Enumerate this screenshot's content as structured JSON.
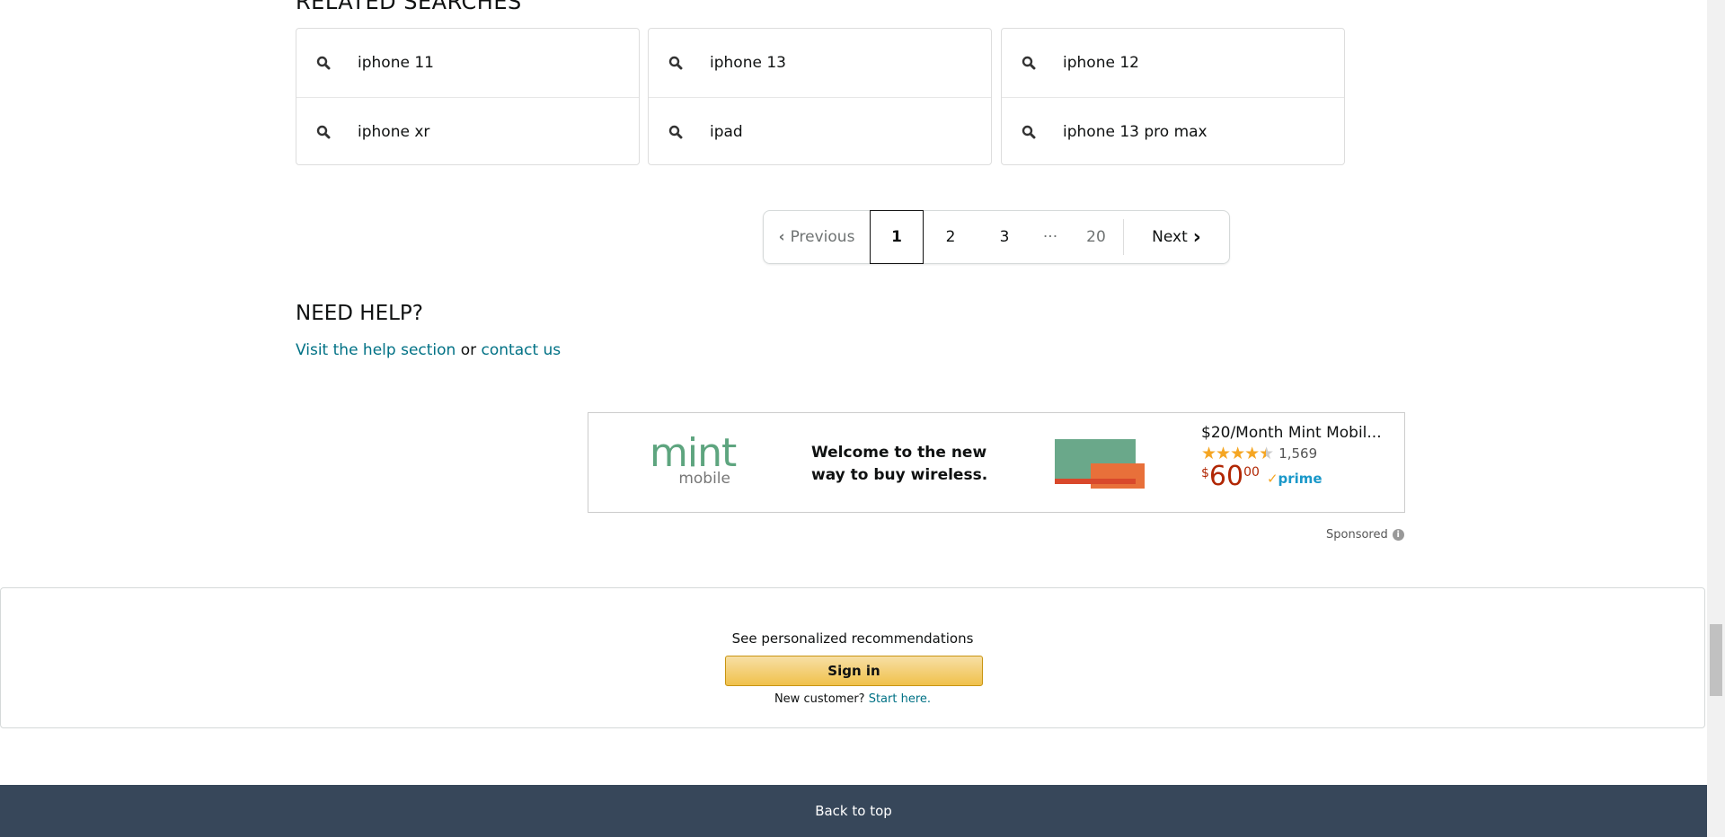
{
  "related": {
    "title": "RELATED SEARCHES",
    "columns": [
      [
        "iphone 11",
        "iphone xr"
      ],
      [
        "iphone 13",
        "ipad"
      ],
      [
        "iphone 12",
        "iphone 13 pro max"
      ]
    ]
  },
  "pagination": {
    "previous": "Previous",
    "current": "1",
    "pages": [
      "2",
      "3"
    ],
    "ellipsis": "···",
    "last": "20",
    "next": "Next"
  },
  "help": {
    "title": "NEED HELP?",
    "link1": "Visit the help section",
    "or": " or ",
    "link2": "contact us"
  },
  "ad": {
    "brand_logo": "mint mobile",
    "tagline_1": "Welcome to the new",
    "tagline_2": "way to buy wireless.",
    "product_title": "$20/Month Mint Mobil...",
    "rating": 4.5,
    "reviews": "1,569",
    "price_symbol": "$",
    "price_whole": "60",
    "price_fraction": "00",
    "prime": "prime",
    "sponsored": "Sponsored"
  },
  "signin": {
    "text": "See personalized recommendations",
    "button": "Sign in",
    "new_customer": "New customer? ",
    "start_here": "Start here."
  },
  "footer": {
    "back_to_top": "Back to top"
  }
}
